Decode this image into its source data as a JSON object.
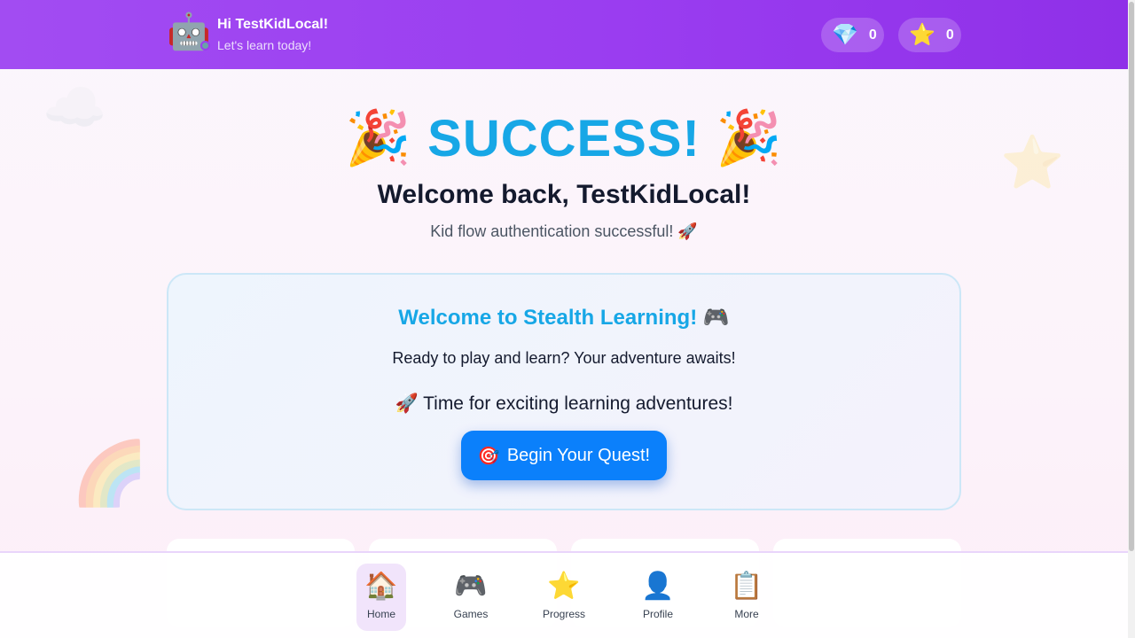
{
  "header": {
    "avatar": "robot-icon",
    "greeting": "Hi TestKidLocal!",
    "subtitle": "Let's learn today!",
    "gems": {
      "icon": "gem-icon",
      "glyph": "💎",
      "count": "0"
    },
    "stars": {
      "icon": "star-icon",
      "glyph": "⭐",
      "count": "0"
    }
  },
  "hero": {
    "party_glyph": "🎉",
    "title": "SUCCESS!",
    "welcome": "Welcome back, TestKidLocal!",
    "auth_message": "Kid flow authentication successful! 🚀"
  },
  "card": {
    "title": "Welcome to Stealth Learning! 🎮",
    "text": "Ready to play and learn? Your adventure awaits!",
    "adventure": "🚀 Time for exciting learning adventures!",
    "button_glyph": "🎯",
    "button_label": "Begin Your Quest!"
  },
  "nav": {
    "items": [
      {
        "label": "Home",
        "icon": "home-icon",
        "glyph": "🏠",
        "active": true
      },
      {
        "label": "Games",
        "icon": "game-controller-icon",
        "glyph": "🎮",
        "active": false
      },
      {
        "label": "Progress",
        "icon": "star-icon",
        "glyph": "⭐",
        "active": false
      },
      {
        "label": "Profile",
        "icon": "profile-icon",
        "glyph": "👤",
        "active": false
      },
      {
        "label": "More",
        "icon": "clipboard-icon",
        "glyph": "📋",
        "active": false
      }
    ]
  },
  "colors": {
    "header": "#9a3df0",
    "accent": "#17a7e6",
    "button": "#0b80fb"
  }
}
